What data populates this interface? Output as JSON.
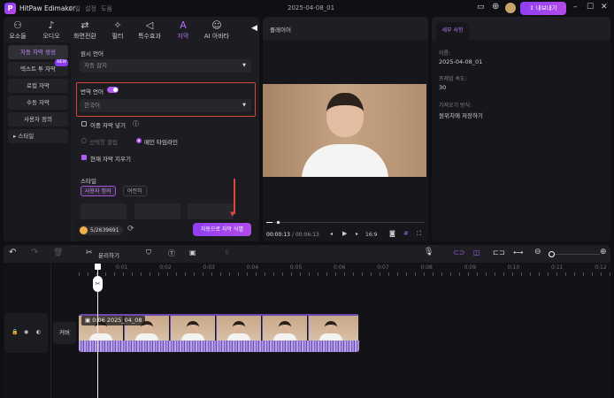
{
  "app": {
    "title": "HitPaw Edimakor",
    "menu": [
      "파일",
      "설정",
      "도움"
    ],
    "project": "2025-04-08_01",
    "export": "내보내기"
  },
  "toolbar": [
    {
      "label": "요소들",
      "icon": "elements-icon"
    },
    {
      "label": "오디오",
      "icon": "audio-icon"
    },
    {
      "label": "화면전환",
      "icon": "transition-icon"
    },
    {
      "label": "필터",
      "icon": "filter-icon"
    },
    {
      "label": "특수효과",
      "icon": "effects-icon"
    },
    {
      "label": "자막",
      "icon": "subtitle-icon"
    },
    {
      "label": "AI 아바타",
      "icon": "avatar-icon"
    }
  ],
  "sidebar": [
    {
      "label": "자동 자막 생성"
    },
    {
      "label": "텍스트 투 자막",
      "badge": "NEW"
    },
    {
      "label": "로컬 자막"
    },
    {
      "label": "수동 자막"
    },
    {
      "label": "사용자 정의"
    },
    {
      "label": "스타일"
    }
  ],
  "subtitle": {
    "source_label": "원시 언어",
    "source_value": "자동 감지",
    "translate_label": "번역 언어",
    "translate_on": true,
    "translate_value": "한국어",
    "dual": "이중 자막 넣기",
    "opt_selected": "선택한 클립",
    "opt_main": "메인 타임라인",
    "clear": "현재 자막 지우기",
    "style_label": "스타일",
    "style_tabs": [
      "사용자 정의",
      "여전히"
    ],
    "credits": "5/2639691",
    "generate": "자동으로 자막 식별"
  },
  "player": {
    "title": "플레이어",
    "current": "00:00:13",
    "total": "/ 00:06:13",
    "ratio": "16:9",
    "progress": 0.04
  },
  "details": {
    "tab": "세부 사항",
    "name_label": "이름:",
    "name": "2025-04-08_01",
    "fps_label": "프레임 속도:",
    "fps": "30",
    "import_label": "가져오기 방식:",
    "import": "원위치에 저장하기"
  },
  "timeline": {
    "split": "분리하기",
    "ticks": [
      "0:01",
      "0:02",
      "0:03",
      "0:04",
      "0:05",
      "0:06",
      "0:07",
      "0:08",
      "0:09",
      "0:10",
      "0:11",
      "0:12"
    ],
    "cover": "커버",
    "clip": "0:06 2025_04_08"
  }
}
